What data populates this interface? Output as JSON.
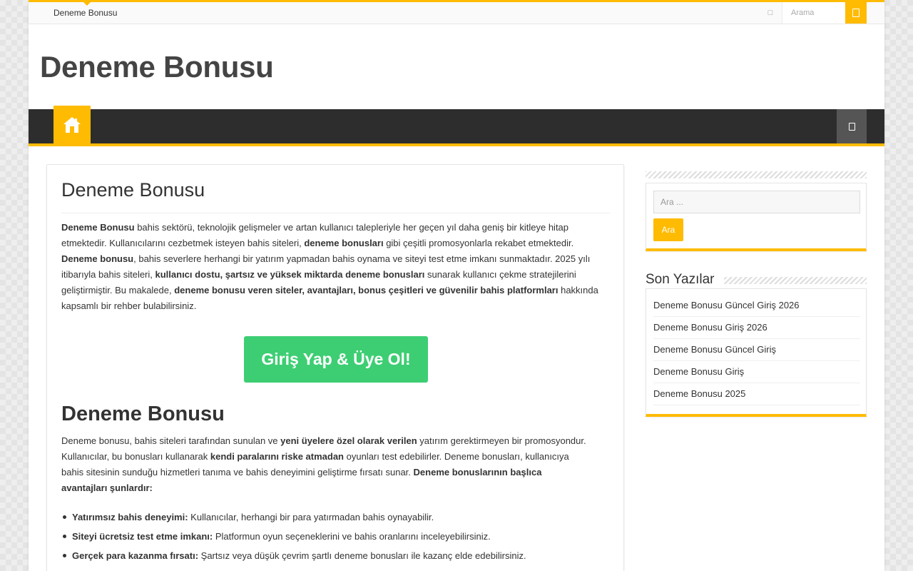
{
  "topbar": {
    "link_label": "Deneme Bonusu",
    "social_icon": "rss-icon",
    "search_placeholder": "Arama",
    "search_button_icon": "search-icon"
  },
  "header": {
    "site_title": "Deneme Bonusu"
  },
  "nav": {
    "home_icon": "home-icon",
    "right_icon": "random-icon"
  },
  "post": {
    "title": "Deneme Bonusu",
    "cta_label": "Giriş Yap & Üye Ol!",
    "h2": "Deneme Bonusu",
    "p1": [
      {
        "t": "Deneme Bonusu",
        "b": true
      },
      {
        "t": " bahis sektörü, teknolojik gelişmeler ve artan kullanıcı talepleriyle her geçen yıl daha geniş bir kitleye hitap etmektedir. Kullanıcılarını cezbetmek isteyen bahis siteleri, ",
        "b": false
      },
      {
        "t": "deneme bonusları",
        "b": true
      },
      {
        "t": " gibi çeşitli promosyonlarla rekabet etmektedir. ",
        "b": false
      },
      {
        "t": "Deneme bonusu",
        "b": true
      },
      {
        "t": ", bahis severlere herhangi bir yatırım yapmadan bahis oynama ve siteyi test etme imkanı sunmaktadır. 2025 yılı itibarıyla bahis siteleri, ",
        "b": false
      },
      {
        "t": "kullanıcı dostu, şartsız ve yüksek miktarda deneme bonusları",
        "b": true
      },
      {
        "t": " sunarak kullanıcı çekme stratejilerini geliştirmiştir. Bu makalede, ",
        "b": false
      },
      {
        "t": "deneme bonusu veren siteler, avantajları, bonus çeşitleri ve güvenilir bahis platformları",
        "b": true
      },
      {
        "t": " hakkında kapsamlı bir rehber bulabilirsiniz.",
        "b": false
      }
    ],
    "p2": [
      {
        "t": "Deneme bonusu, bahis siteleri tarafından sunulan ve ",
        "b": false
      },
      {
        "t": "yeni üyelere özel olarak verilen",
        "b": true
      },
      {
        "t": " yatırım gerektirmeyen bir promosyondur. Kullanıcılar, bu bonusları kullanarak ",
        "b": false
      },
      {
        "t": "kendi paralarını riske atmadan",
        "b": true
      },
      {
        "t": " oyunları test edebilirler. Deneme bonusları, kullanıcıya bahis sitesinin sunduğu hizmetleri tanıma ve bahis deneyimini geliştirme fırsatı sunar. ",
        "b": false
      },
      {
        "t": "Deneme bonuslarının başlıca avantajları şunlardır:",
        "b": true
      }
    ],
    "bullets": [
      {
        "bold": "Yatırımsız bahis deneyimi:",
        "text": " Kullanıcılar, herhangi bir para yatırmadan bahis oynayabilir."
      },
      {
        "bold": "Siteyi ücretsiz test etme imkanı:",
        "text": " Platformun oyun seçeneklerini ve bahis oranlarını inceleyebilirsiniz."
      },
      {
        "bold": "Gerçek para kazanma fırsatı:",
        "text": " Şartsız veya düşük çevrim şartlı deneme bonusları ile kazanç elde edebilirsiniz."
      }
    ]
  },
  "sidebar": {
    "search_placeholder": "Ara ...",
    "search_button": "Ara",
    "recent_title": "Son Yazılar",
    "recent": [
      "Deneme Bonusu Güncel Giriş 2026",
      "Deneme Bonusu Giriş 2026",
      "Deneme Bonusu Güncel Giriş",
      "Deneme Bonusu Giriş",
      "Deneme Bonusu 2025"
    ]
  },
  "colors": {
    "accent": "#ffbb01",
    "nav_bg": "#2d2d2d",
    "cta": "#3dce73"
  }
}
